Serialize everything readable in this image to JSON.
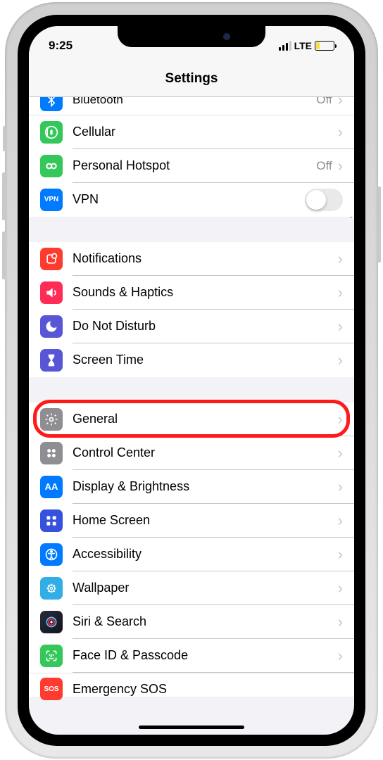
{
  "status": {
    "time": "9:25",
    "network": "LTE"
  },
  "header": {
    "title": "Settings"
  },
  "rows": {
    "bluetooth": {
      "label": "Bluetooth",
      "value": "Off"
    },
    "cellular": {
      "label": "Cellular"
    },
    "hotspot": {
      "label": "Personal Hotspot",
      "value": "Off"
    },
    "vpn": {
      "label": "VPN",
      "badge": "VPN"
    },
    "notifications": {
      "label": "Notifications"
    },
    "sounds": {
      "label": "Sounds & Haptics"
    },
    "dnd": {
      "label": "Do Not Disturb"
    },
    "screentime": {
      "label": "Screen Time"
    },
    "general": {
      "label": "General"
    },
    "control": {
      "label": "Control Center"
    },
    "display": {
      "label": "Display & Brightness",
      "badge": "AA"
    },
    "home": {
      "label": "Home Screen"
    },
    "accessibility": {
      "label": "Accessibility"
    },
    "wallpaper": {
      "label": "Wallpaper"
    },
    "siri": {
      "label": "Siri & Search"
    },
    "faceid": {
      "label": "Face ID & Passcode"
    },
    "sos": {
      "label": "Emergency SOS",
      "badge": "SOS"
    }
  },
  "colors": {
    "blue": "#007aff",
    "green": "#34c759",
    "gray": "#8e8e93",
    "red": "#ff3b30",
    "purple": "#5856d6",
    "cyan": "#32ade6",
    "pink": "#ff2d55",
    "indigo": "#5e5ce6"
  }
}
